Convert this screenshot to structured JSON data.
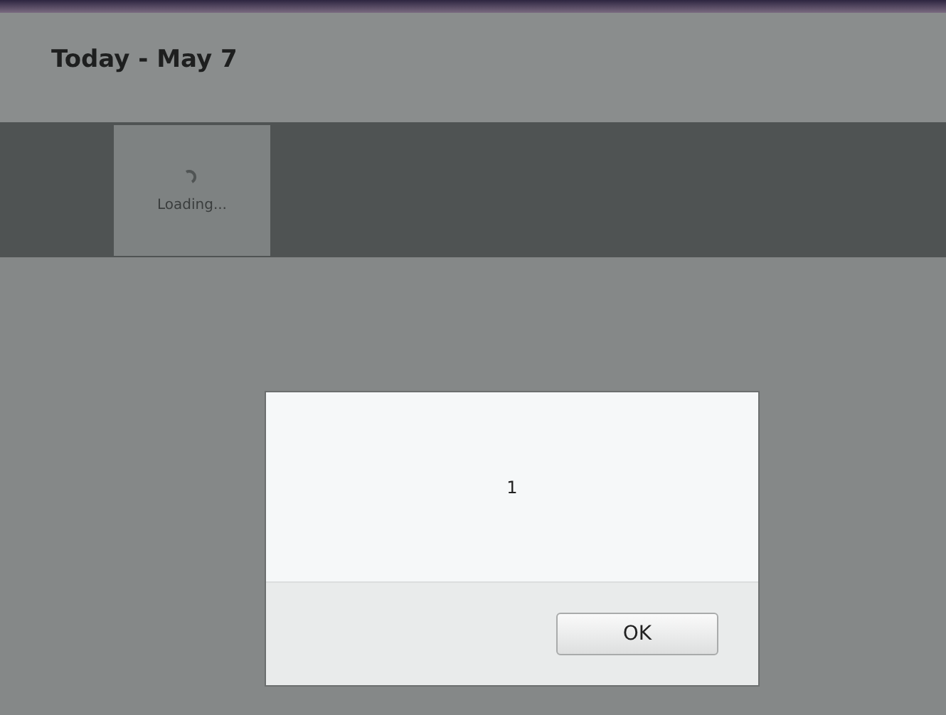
{
  "header": {
    "title": "Today - May 7"
  },
  "tile": {
    "caption": "Loading..."
  },
  "dialog": {
    "message": "1",
    "buttons": [
      "OK"
    ]
  }
}
